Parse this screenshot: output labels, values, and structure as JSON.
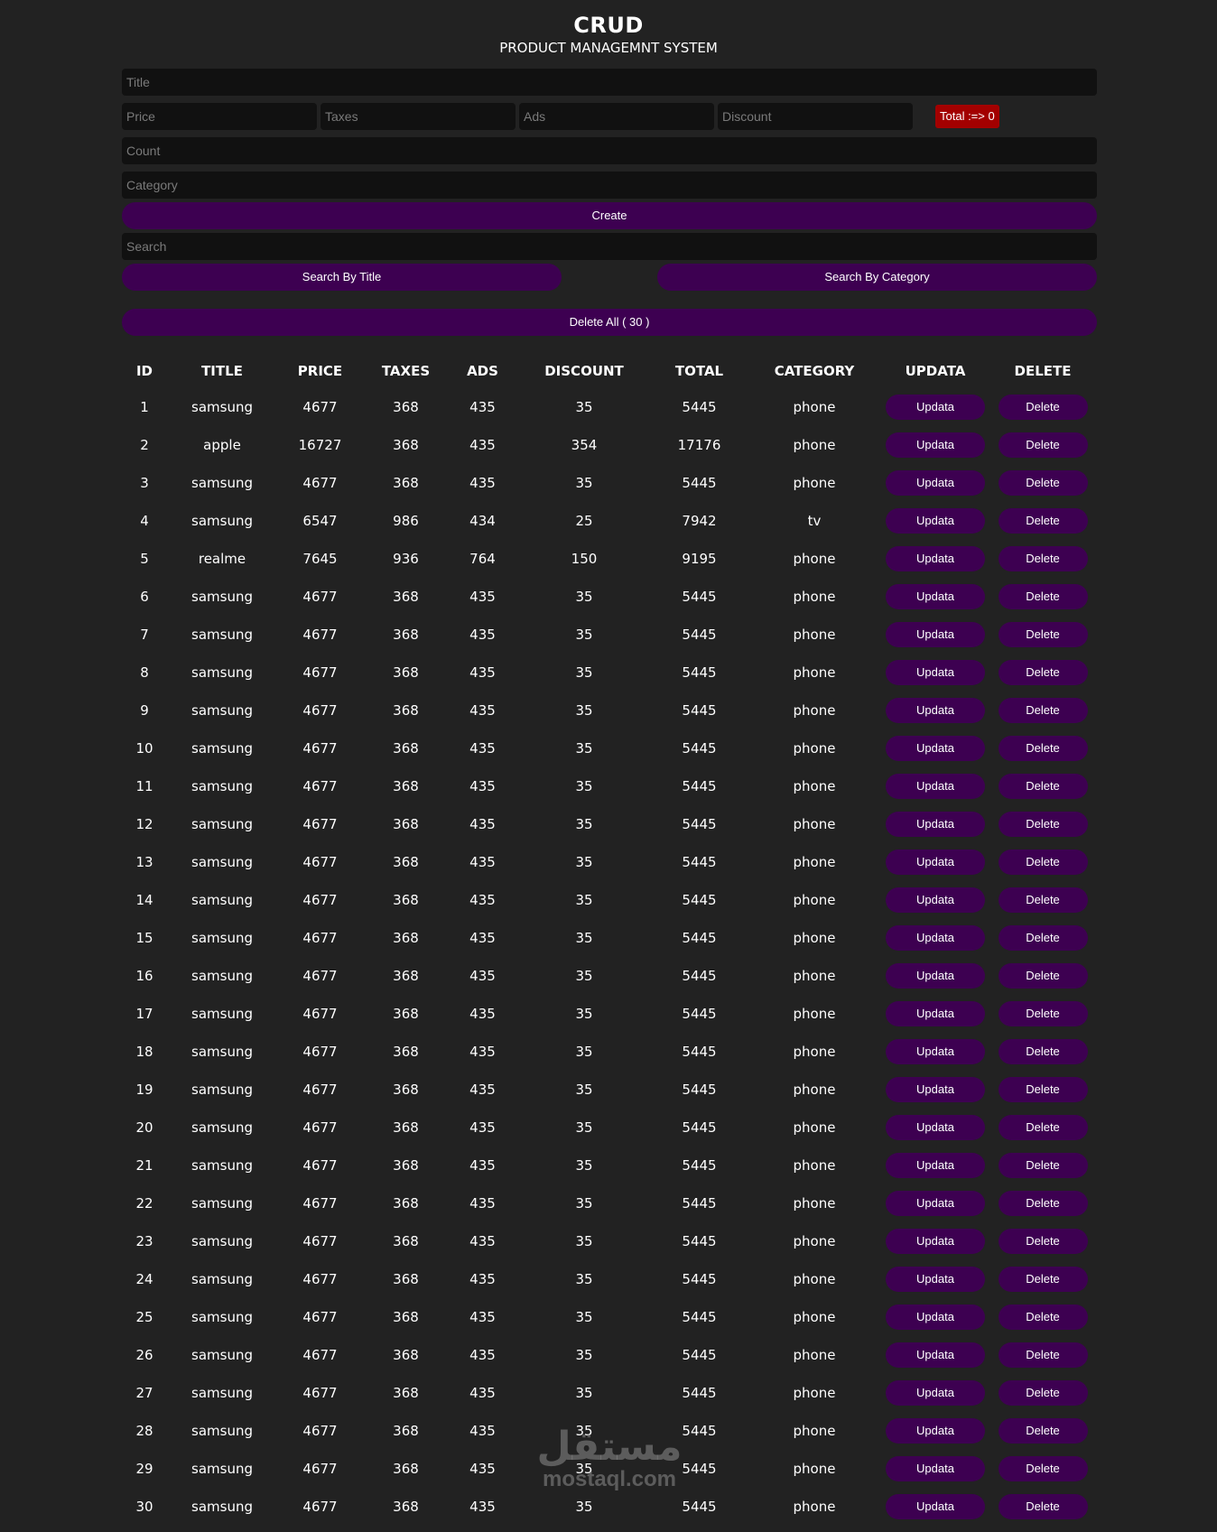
{
  "header": {
    "title": "CRUD",
    "subtitle": "PRODUCT MANAGEMNT SYSTEM"
  },
  "form": {
    "title_placeholder": "Title",
    "price_placeholder": "Price",
    "taxes_placeholder": "Taxes",
    "ads_placeholder": "Ads",
    "discount_placeholder": "Discount",
    "total_label": "Total :=> 0",
    "count_placeholder": "Count",
    "category_placeholder": "Category",
    "create_label": "Create",
    "search_placeholder": "Search",
    "search_by_title_label": "Search By Title",
    "search_by_category_label": "Search By Category",
    "delete_all_label": "Delete All ( 30 )"
  },
  "table": {
    "headers": [
      "ID",
      "TITLE",
      "PRICE",
      "TAXES",
      "ADS",
      "DISCOUNT",
      "TOTAL",
      "CATEGORY",
      "UPDATA",
      "DELETE"
    ],
    "update_label": "Updata",
    "delete_label": "Delete",
    "rows": [
      {
        "id": "1",
        "title": "samsung",
        "price": "4677",
        "taxes": "368",
        "ads": "435",
        "discount": "35",
        "total": "5445",
        "category": "phone"
      },
      {
        "id": "2",
        "title": "apple",
        "price": "16727",
        "taxes": "368",
        "ads": "435",
        "discount": "354",
        "total": "17176",
        "category": "phone"
      },
      {
        "id": "3",
        "title": "samsung",
        "price": "4677",
        "taxes": "368",
        "ads": "435",
        "discount": "35",
        "total": "5445",
        "category": "phone"
      },
      {
        "id": "4",
        "title": "samsung",
        "price": "6547",
        "taxes": "986",
        "ads": "434",
        "discount": "25",
        "total": "7942",
        "category": "tv"
      },
      {
        "id": "5",
        "title": "realme",
        "price": "7645",
        "taxes": "936",
        "ads": "764",
        "discount": "150",
        "total": "9195",
        "category": "phone"
      },
      {
        "id": "6",
        "title": "samsung",
        "price": "4677",
        "taxes": "368",
        "ads": "435",
        "discount": "35",
        "total": "5445",
        "category": "phone"
      },
      {
        "id": "7",
        "title": "samsung",
        "price": "4677",
        "taxes": "368",
        "ads": "435",
        "discount": "35",
        "total": "5445",
        "category": "phone"
      },
      {
        "id": "8",
        "title": "samsung",
        "price": "4677",
        "taxes": "368",
        "ads": "435",
        "discount": "35",
        "total": "5445",
        "category": "phone"
      },
      {
        "id": "9",
        "title": "samsung",
        "price": "4677",
        "taxes": "368",
        "ads": "435",
        "discount": "35",
        "total": "5445",
        "category": "phone"
      },
      {
        "id": "10",
        "title": "samsung",
        "price": "4677",
        "taxes": "368",
        "ads": "435",
        "discount": "35",
        "total": "5445",
        "category": "phone"
      },
      {
        "id": "11",
        "title": "samsung",
        "price": "4677",
        "taxes": "368",
        "ads": "435",
        "discount": "35",
        "total": "5445",
        "category": "phone"
      },
      {
        "id": "12",
        "title": "samsung",
        "price": "4677",
        "taxes": "368",
        "ads": "435",
        "discount": "35",
        "total": "5445",
        "category": "phone"
      },
      {
        "id": "13",
        "title": "samsung",
        "price": "4677",
        "taxes": "368",
        "ads": "435",
        "discount": "35",
        "total": "5445",
        "category": "phone"
      },
      {
        "id": "14",
        "title": "samsung",
        "price": "4677",
        "taxes": "368",
        "ads": "435",
        "discount": "35",
        "total": "5445",
        "category": "phone"
      },
      {
        "id": "15",
        "title": "samsung",
        "price": "4677",
        "taxes": "368",
        "ads": "435",
        "discount": "35",
        "total": "5445",
        "category": "phone"
      },
      {
        "id": "16",
        "title": "samsung",
        "price": "4677",
        "taxes": "368",
        "ads": "435",
        "discount": "35",
        "total": "5445",
        "category": "phone"
      },
      {
        "id": "17",
        "title": "samsung",
        "price": "4677",
        "taxes": "368",
        "ads": "435",
        "discount": "35",
        "total": "5445",
        "category": "phone"
      },
      {
        "id": "18",
        "title": "samsung",
        "price": "4677",
        "taxes": "368",
        "ads": "435",
        "discount": "35",
        "total": "5445",
        "category": "phone"
      },
      {
        "id": "19",
        "title": "samsung",
        "price": "4677",
        "taxes": "368",
        "ads": "435",
        "discount": "35",
        "total": "5445",
        "category": "phone"
      },
      {
        "id": "20",
        "title": "samsung",
        "price": "4677",
        "taxes": "368",
        "ads": "435",
        "discount": "35",
        "total": "5445",
        "category": "phone"
      },
      {
        "id": "21",
        "title": "samsung",
        "price": "4677",
        "taxes": "368",
        "ads": "435",
        "discount": "35",
        "total": "5445",
        "category": "phone"
      },
      {
        "id": "22",
        "title": "samsung",
        "price": "4677",
        "taxes": "368",
        "ads": "435",
        "discount": "35",
        "total": "5445",
        "category": "phone"
      },
      {
        "id": "23",
        "title": "samsung",
        "price": "4677",
        "taxes": "368",
        "ads": "435",
        "discount": "35",
        "total": "5445",
        "category": "phone"
      },
      {
        "id": "24",
        "title": "samsung",
        "price": "4677",
        "taxes": "368",
        "ads": "435",
        "discount": "35",
        "total": "5445",
        "category": "phone"
      },
      {
        "id": "25",
        "title": "samsung",
        "price": "4677",
        "taxes": "368",
        "ads": "435",
        "discount": "35",
        "total": "5445",
        "category": "phone"
      },
      {
        "id": "26",
        "title": "samsung",
        "price": "4677",
        "taxes": "368",
        "ads": "435",
        "discount": "35",
        "total": "5445",
        "category": "phone"
      },
      {
        "id": "27",
        "title": "samsung",
        "price": "4677",
        "taxes": "368",
        "ads": "435",
        "discount": "35",
        "total": "5445",
        "category": "phone"
      },
      {
        "id": "28",
        "title": "samsung",
        "price": "4677",
        "taxes": "368",
        "ads": "435",
        "discount": "35",
        "total": "5445",
        "category": "phone"
      },
      {
        "id": "29",
        "title": "samsung",
        "price": "4677",
        "taxes": "368",
        "ads": "435",
        "discount": "35",
        "total": "5445",
        "category": "phone"
      },
      {
        "id": "30",
        "title": "samsung",
        "price": "4677",
        "taxes": "368",
        "ads": "435",
        "discount": "35",
        "total": "5445",
        "category": "phone"
      }
    ]
  },
  "watermark": {
    "arabic": "مستقل",
    "latin": "mostaql.com"
  },
  "colors": {
    "background": "#222222",
    "input_background": "#111111",
    "button_purple": "#3d0051",
    "total_red": "#a30000",
    "text": "#ffffff"
  }
}
